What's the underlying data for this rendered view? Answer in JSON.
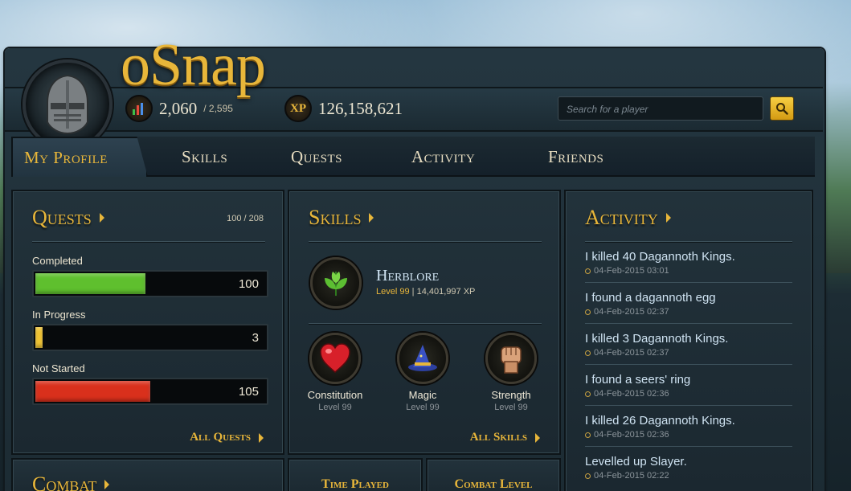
{
  "brand": {
    "name": "oSnap"
  },
  "stats": {
    "total_level": "2,060",
    "total_level_max": "/ 2,595",
    "xp_label": "XP",
    "xp_value": "126,158,621"
  },
  "search": {
    "placeholder": "Search for a player"
  },
  "nav": {
    "tabs": [
      {
        "label": "My Profile"
      },
      {
        "label": "Skills"
      },
      {
        "label": "Quests"
      },
      {
        "label": "Activity"
      },
      {
        "label": "Friends"
      }
    ]
  },
  "quests": {
    "title": "Quests",
    "count": "100 / 208",
    "bars": [
      {
        "label": "Completed",
        "value": "100",
        "fraction": 0.48
      },
      {
        "label": "In Progress",
        "value": "3",
        "fraction": 0.03
      },
      {
        "label": "Not Started",
        "value": "105",
        "fraction": 0.5
      }
    ],
    "link": "All Quests"
  },
  "skills": {
    "title": "Skills",
    "featured": {
      "name": "Herblore",
      "level": "Level 99",
      "separator": "|",
      "xp": "14,401,997 XP"
    },
    "list": [
      {
        "name": "Constitution",
        "level": "Level 99"
      },
      {
        "name": "Magic",
        "level": "Level 99"
      },
      {
        "name": "Strength",
        "level": "Level 99"
      }
    ],
    "link": "All Skills"
  },
  "activity": {
    "title": "Activity",
    "items": [
      {
        "text": "I killed 40 Dagannoth Kings.",
        "date": "04-Feb-2015 03:01"
      },
      {
        "text": "I found a dagannoth egg",
        "date": "04-Feb-2015 02:37"
      },
      {
        "text": "I killed 3 Dagannoth Kings.",
        "date": "04-Feb-2015 02:37"
      },
      {
        "text": "I found a seers' ring",
        "date": "04-Feb-2015 02:36"
      },
      {
        "text": "I killed 26 Dagannoth Kings.",
        "date": "04-Feb-2015 02:36"
      },
      {
        "text": "Levelled up Slayer.",
        "date": "04-Feb-2015 02:22"
      }
    ]
  },
  "bottom": {
    "combat_title": "Combat",
    "time_played_title": "Time Played",
    "combat_level_title": "Combat Level"
  },
  "colors": {
    "gold": "#e8b63a",
    "completed": "#5fbf2e",
    "in_progress": "#f2c531",
    "not_started": "#d9301c"
  }
}
